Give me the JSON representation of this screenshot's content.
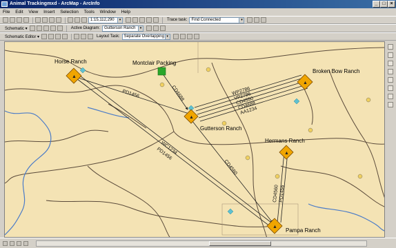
{
  "window": {
    "title": "Animal Trackingmxd - ArcMap - ArcInfo"
  },
  "menu": [
    "File",
    "Edit",
    "View",
    "Insert",
    "Selection",
    "Tools",
    "Window",
    "Help"
  ],
  "toolbar1": {
    "scale": "1:15,112,290",
    "trace_task_label": "Trace task:",
    "trace_task_value": "Find Connected"
  },
  "toolbar2": {
    "schematic_label": "Schematic ▾",
    "active_diagram_label": "Active Diagram:",
    "active_diagram_value": "Gutterson Ranch"
  },
  "toolbar3": {
    "editor_label": "Schematic Editor ▾",
    "layout_task_label": "Layout Task:",
    "layout_task_value": "Separate Overlapping"
  },
  "map": {
    "nodes": [
      {
        "id": "horse",
        "label": "Horse Ranch"
      },
      {
        "id": "gutterson",
        "label": "Gutterson Ranch"
      },
      {
        "id": "broken",
        "label": "Broken Bow Ranch"
      },
      {
        "id": "hermans",
        "label": "Hermans Ranch"
      },
      {
        "id": "pampa",
        "label": "Pampa Ranch"
      }
    ],
    "facility_label": "Montclair Packing",
    "edge_labels": {
      "horse_gutterson": "PD1456",
      "montclair_gutterson": "CD4688",
      "bundle_1": "WP2786",
      "bundle_2": "VP2786",
      "bundle_3": "CD4550",
      "bundle_4": "CD4688",
      "bundle_5": "AA1234",
      "horse_pampa_1": "WC1234",
      "horse_pampa_2": "PD1456",
      "gutterson_pampa": "CD4560",
      "hermans_pampa_1": "CD4560",
      "hermans_pampa_2": "PD1456"
    },
    "colors": {
      "background": "#f4e3b4",
      "river": "#4a7bc8",
      "road": "#5a4a3a",
      "ranch_symbol": "#f0a500",
      "facility": "#2aa62a",
      "diamond_marker": "#5fc0d0"
    }
  }
}
